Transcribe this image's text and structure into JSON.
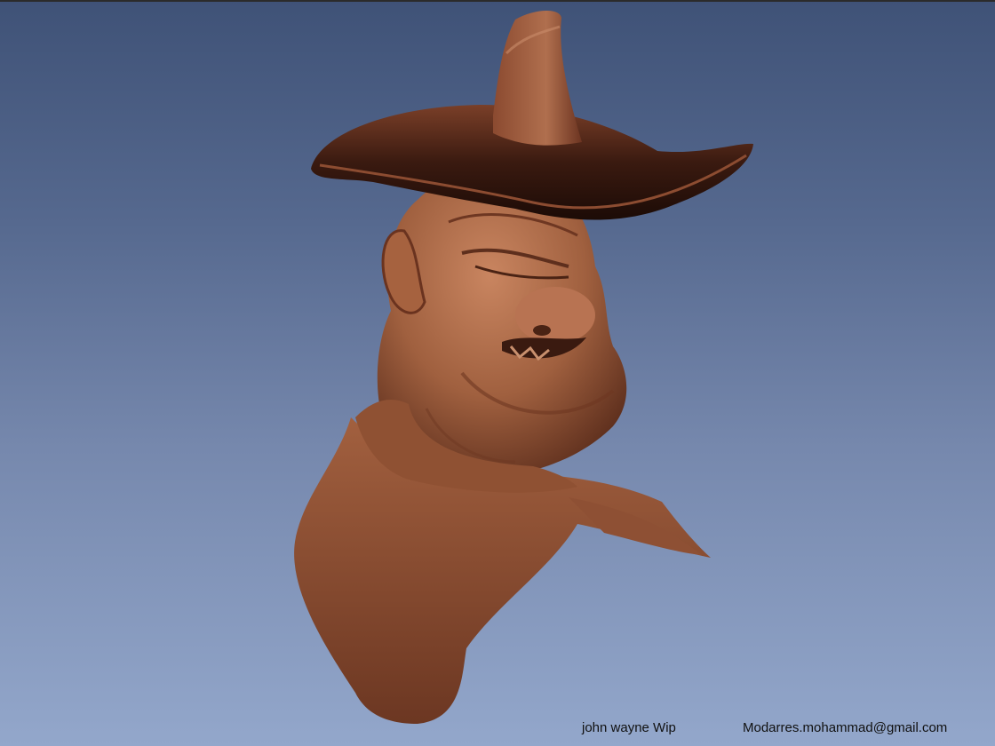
{
  "caption": {
    "title": "john wayne Wip",
    "email": "Modarres.mohammad@gmail.com"
  },
  "colors": {
    "background_top": "#3f5277",
    "background_bottom": "#93a7cb",
    "clay": "#a8674a",
    "clay_dark": "#5a2c1c"
  },
  "figure": {
    "subject_icon": "cowboy-bust-sculpt"
  }
}
